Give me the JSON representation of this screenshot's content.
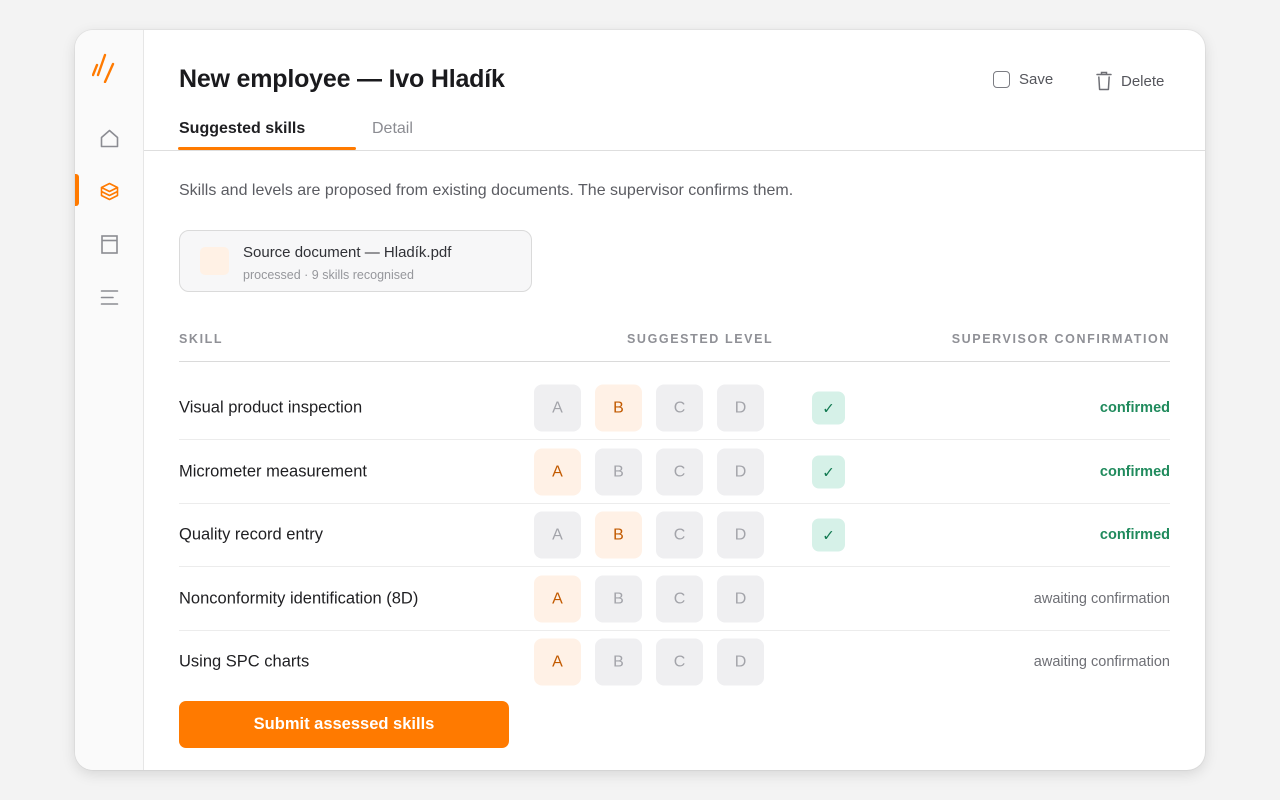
{
  "sidebar": {
    "logo_icon": "brand-logo",
    "items": [
      {
        "name": "home",
        "icon": "home-icon",
        "active": false
      },
      {
        "name": "skills",
        "icon": "cube-icon",
        "active": true
      },
      {
        "name": "documents",
        "icon": "panel-icon",
        "active": false
      },
      {
        "name": "list",
        "icon": "list-icon",
        "active": false
      }
    ]
  },
  "header": {
    "title": "New employee — Ivo Hladík",
    "save_label": "Save",
    "delete_label": "Delete",
    "tabs": [
      {
        "label": "Suggested skills",
        "active": true
      },
      {
        "label": "Detail",
        "active": false
      }
    ]
  },
  "intro": "Skills and levels are proposed from existing documents. The supervisor confirms them.",
  "document": {
    "name": "Source document — Hladík.pdf",
    "meta": "processed · 9 skills recognised"
  },
  "table": {
    "columns": {
      "skill": "SKILL",
      "level": "SUGGESTED LEVEL",
      "confirmation": "SUPERVISOR CONFIRMATION"
    },
    "levels": [
      "A",
      "B",
      "C",
      "D"
    ],
    "rows": [
      {
        "skill": "Visual product inspection",
        "level": "B",
        "confirmed": true,
        "status": "confirmed"
      },
      {
        "skill": "Micrometer measurement",
        "level": "A",
        "confirmed": true,
        "status": "confirmed"
      },
      {
        "skill": "Quality record entry",
        "level": "B",
        "confirmed": true,
        "status": "confirmed"
      },
      {
        "skill": "Nonconformity identification (8D)",
        "level": "A",
        "confirmed": false,
        "status": "awaiting confirmation"
      },
      {
        "skill": "Using SPC charts",
        "level": "A",
        "confirmed": false,
        "status": "awaiting confirmation"
      }
    ]
  },
  "submit_label": "Submit assessed skills",
  "colors": {
    "accent": "#ff7a00",
    "confirmed": "#1f8a5c",
    "selected_level_bg": "#fff1e6",
    "selected_level_text": "#c25a00"
  }
}
